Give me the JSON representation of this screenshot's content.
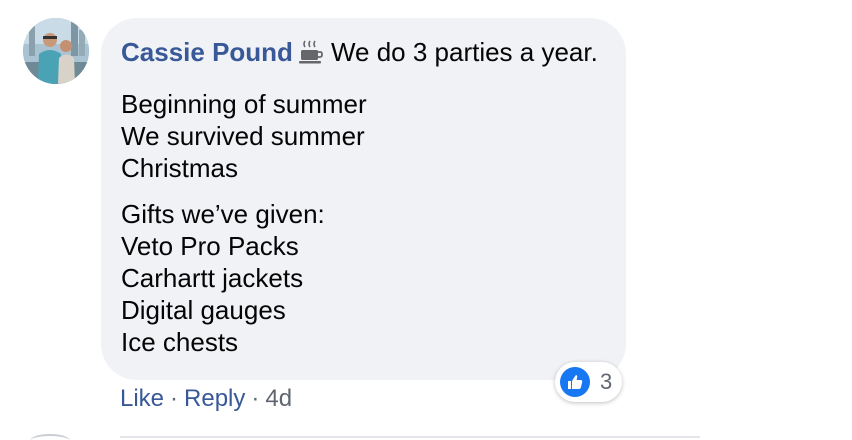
{
  "comment": {
    "author": "Cassie Pound",
    "badge_icon": "coffee-cup-icon",
    "first_line": "We do 3 parties a year.",
    "paragraph1": [
      "Beginning of summer",
      "We survived summer",
      "Christmas"
    ],
    "paragraph2": [
      "Gifts we’ve given:",
      "Veto Pro Packs",
      "Carhartt jackets",
      "Digital gauges",
      "Ice chests"
    ]
  },
  "actions": {
    "like_label": "Like",
    "separator": "·",
    "reply_label": "Reply",
    "timestamp": "4d"
  },
  "reactions": {
    "icon": "thumbs-up-icon",
    "count": "3"
  },
  "colors": {
    "author_link": "#385898",
    "bubble_bg": "#f0f2f5",
    "like_blue": "#1877f2",
    "meta_gray": "#606770"
  }
}
